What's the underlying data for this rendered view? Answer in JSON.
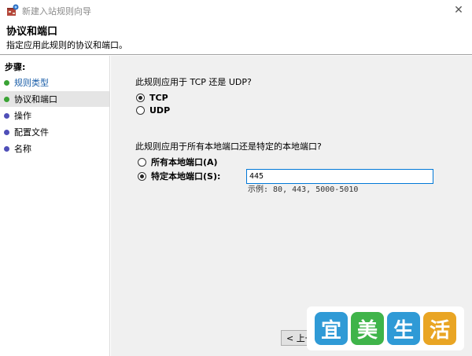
{
  "window": {
    "title": "新建入站规则向导",
    "close_glyph": "✕"
  },
  "header": {
    "title": "协议和端口",
    "description": "指定应用此规则的协议和端口。"
  },
  "sidebar": {
    "steps_label": "步骤:",
    "steps": [
      {
        "label": "规则类型",
        "state": "done",
        "dot_color": "#3aa335"
      },
      {
        "label": "协议和端口",
        "state": "current",
        "dot_color": "#3aa335"
      },
      {
        "label": "操作",
        "state": "pending",
        "dot_color": "#4f4fb8"
      },
      {
        "label": "配置文件",
        "state": "pending",
        "dot_color": "#4f4fb8"
      },
      {
        "label": "名称",
        "state": "pending",
        "dot_color": "#4f4fb8"
      }
    ]
  },
  "main": {
    "protocol_question": "此规则应用于 TCP 还是 UDP?",
    "protocol_options": [
      {
        "label": "TCP",
        "checked": true
      },
      {
        "label": "UDP",
        "checked": false
      }
    ],
    "port_question": "此规则应用于所有本地端口还是特定的本地端口?",
    "port_options": [
      {
        "label": "所有本地端口(A)",
        "checked": false
      },
      {
        "label": "特定本地端口(S):",
        "checked": true
      }
    ],
    "port_value": "445",
    "port_example": "示例: 80, 443, 5000-5010"
  },
  "footer": {
    "back_label": "< 上一"
  },
  "watermark": {
    "chars": [
      "宜",
      "美",
      "生",
      "活"
    ],
    "colors": [
      "#2f9ad6",
      "#3fb44a",
      "#2f9ad6",
      "#e9a524"
    ]
  }
}
